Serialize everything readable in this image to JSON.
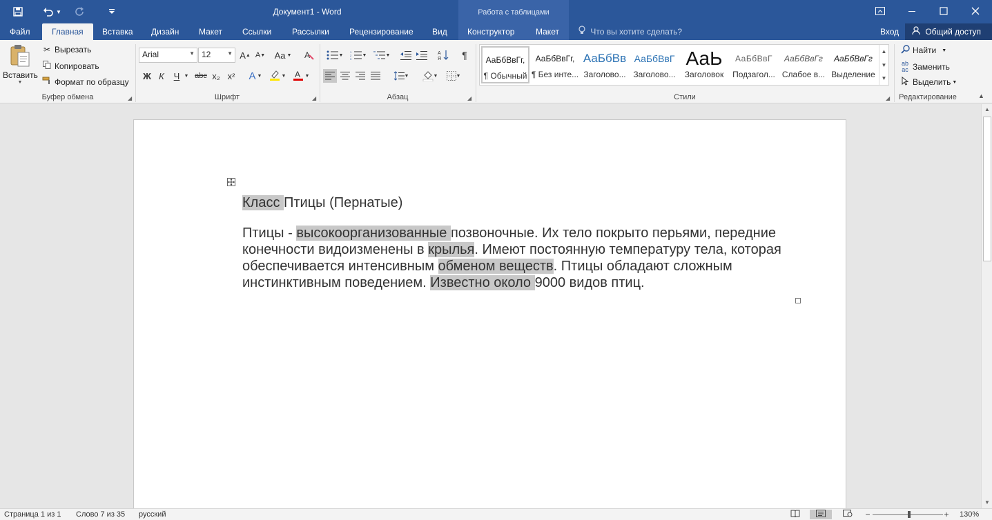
{
  "title_bar": {
    "document_title": "Документ1 - Word",
    "context_header": "Работа с таблицами",
    "quick_access": {
      "save_icon": "save-icon",
      "undo_icon": "undo-icon",
      "redo_icon": "redo-icon",
      "customize_icon": "customize-qat-icon"
    },
    "window_buttons": {
      "ribbon_options": "ribbon-display-options-icon",
      "minimize": "minimize-icon",
      "maximize": "maximize-icon",
      "close": "close-icon"
    }
  },
  "tabs": [
    {
      "label": "Файл",
      "active": false
    },
    {
      "label": "Главная",
      "active": true
    },
    {
      "label": "Вставка",
      "active": false
    },
    {
      "label": "Дизайн",
      "active": false
    },
    {
      "label": "Макет",
      "active": false
    },
    {
      "label": "Ссылки",
      "active": false
    },
    {
      "label": "Рассылки",
      "active": false
    },
    {
      "label": "Рецензирование",
      "active": false
    },
    {
      "label": "Вид",
      "active": false
    },
    {
      "label": "Конструктор",
      "active": false
    },
    {
      "label": "Макет",
      "active": false
    }
  ],
  "tell_me": "Что вы хотите сделать?",
  "sign_in": "Вход",
  "share": "Общий доступ",
  "clipboard": {
    "paste": "Вставить",
    "cut": "Вырезать",
    "copy": "Копировать",
    "format_painter": "Формат по образцу",
    "label": "Буфер обмена"
  },
  "font": {
    "family": "Arial",
    "size": "12",
    "label": "Шрифт",
    "case_label": "Aa",
    "bold": "Ж",
    "italic": "К",
    "underline": "Ч",
    "strike": "abc",
    "subscript": "x₂",
    "superscript": "x²",
    "highlight_color": "#ffe600",
    "font_color": "#e00000"
  },
  "paragraph": {
    "label": "Абзац"
  },
  "styles": {
    "label": "Стили",
    "items": [
      {
        "sample": "АаБбВвГг,",
        "name": "¶ Обычный",
        "selected": true
      },
      {
        "sample": "АаБбВвГг,",
        "name": "¶ Без инте...",
        "selected": false
      },
      {
        "sample": "АаБбВв",
        "name": "Заголово...",
        "selected": false
      },
      {
        "sample": "АаБбВвГ",
        "name": "Заголово...",
        "selected": false
      },
      {
        "sample": "АаЬ",
        "name": "Заголовок",
        "selected": false
      },
      {
        "sample": "АаБбВвГ",
        "name": "Подзагол...",
        "selected": false
      },
      {
        "sample": "АаБбВвГг",
        "name": "Слабое в...",
        "selected": false
      },
      {
        "sample": "АаБбВвГг",
        "name": "Выделение",
        "selected": false
      }
    ]
  },
  "editing": {
    "label": "Редактирование",
    "find": "Найти",
    "replace": "Заменить",
    "select": "Выделить"
  },
  "document": {
    "heading_parts": [
      "Класс ",
      "Птицы (Пернатые)"
    ],
    "paragraph_parts": [
      "Птицы - ",
      "высокоорганизованные ",
      "позвоночные. Их тело покрыто перьями, передние конечности видоизменены в ",
      "крылья",
      ". Имеют постоянную температуру тела, которая обеспечивается интенсивным ",
      "обменом веществ",
      ". Птицы обладают сложным инстинктивным поведением. ",
      "Известно около ",
      "9000 видов птиц."
    ]
  },
  "status_bar": {
    "page": "Страница 1 из 1",
    "words": "Слово 7 из 35",
    "language": "русский",
    "zoom": "130%",
    "zoom_level_fraction": 0.52
  }
}
